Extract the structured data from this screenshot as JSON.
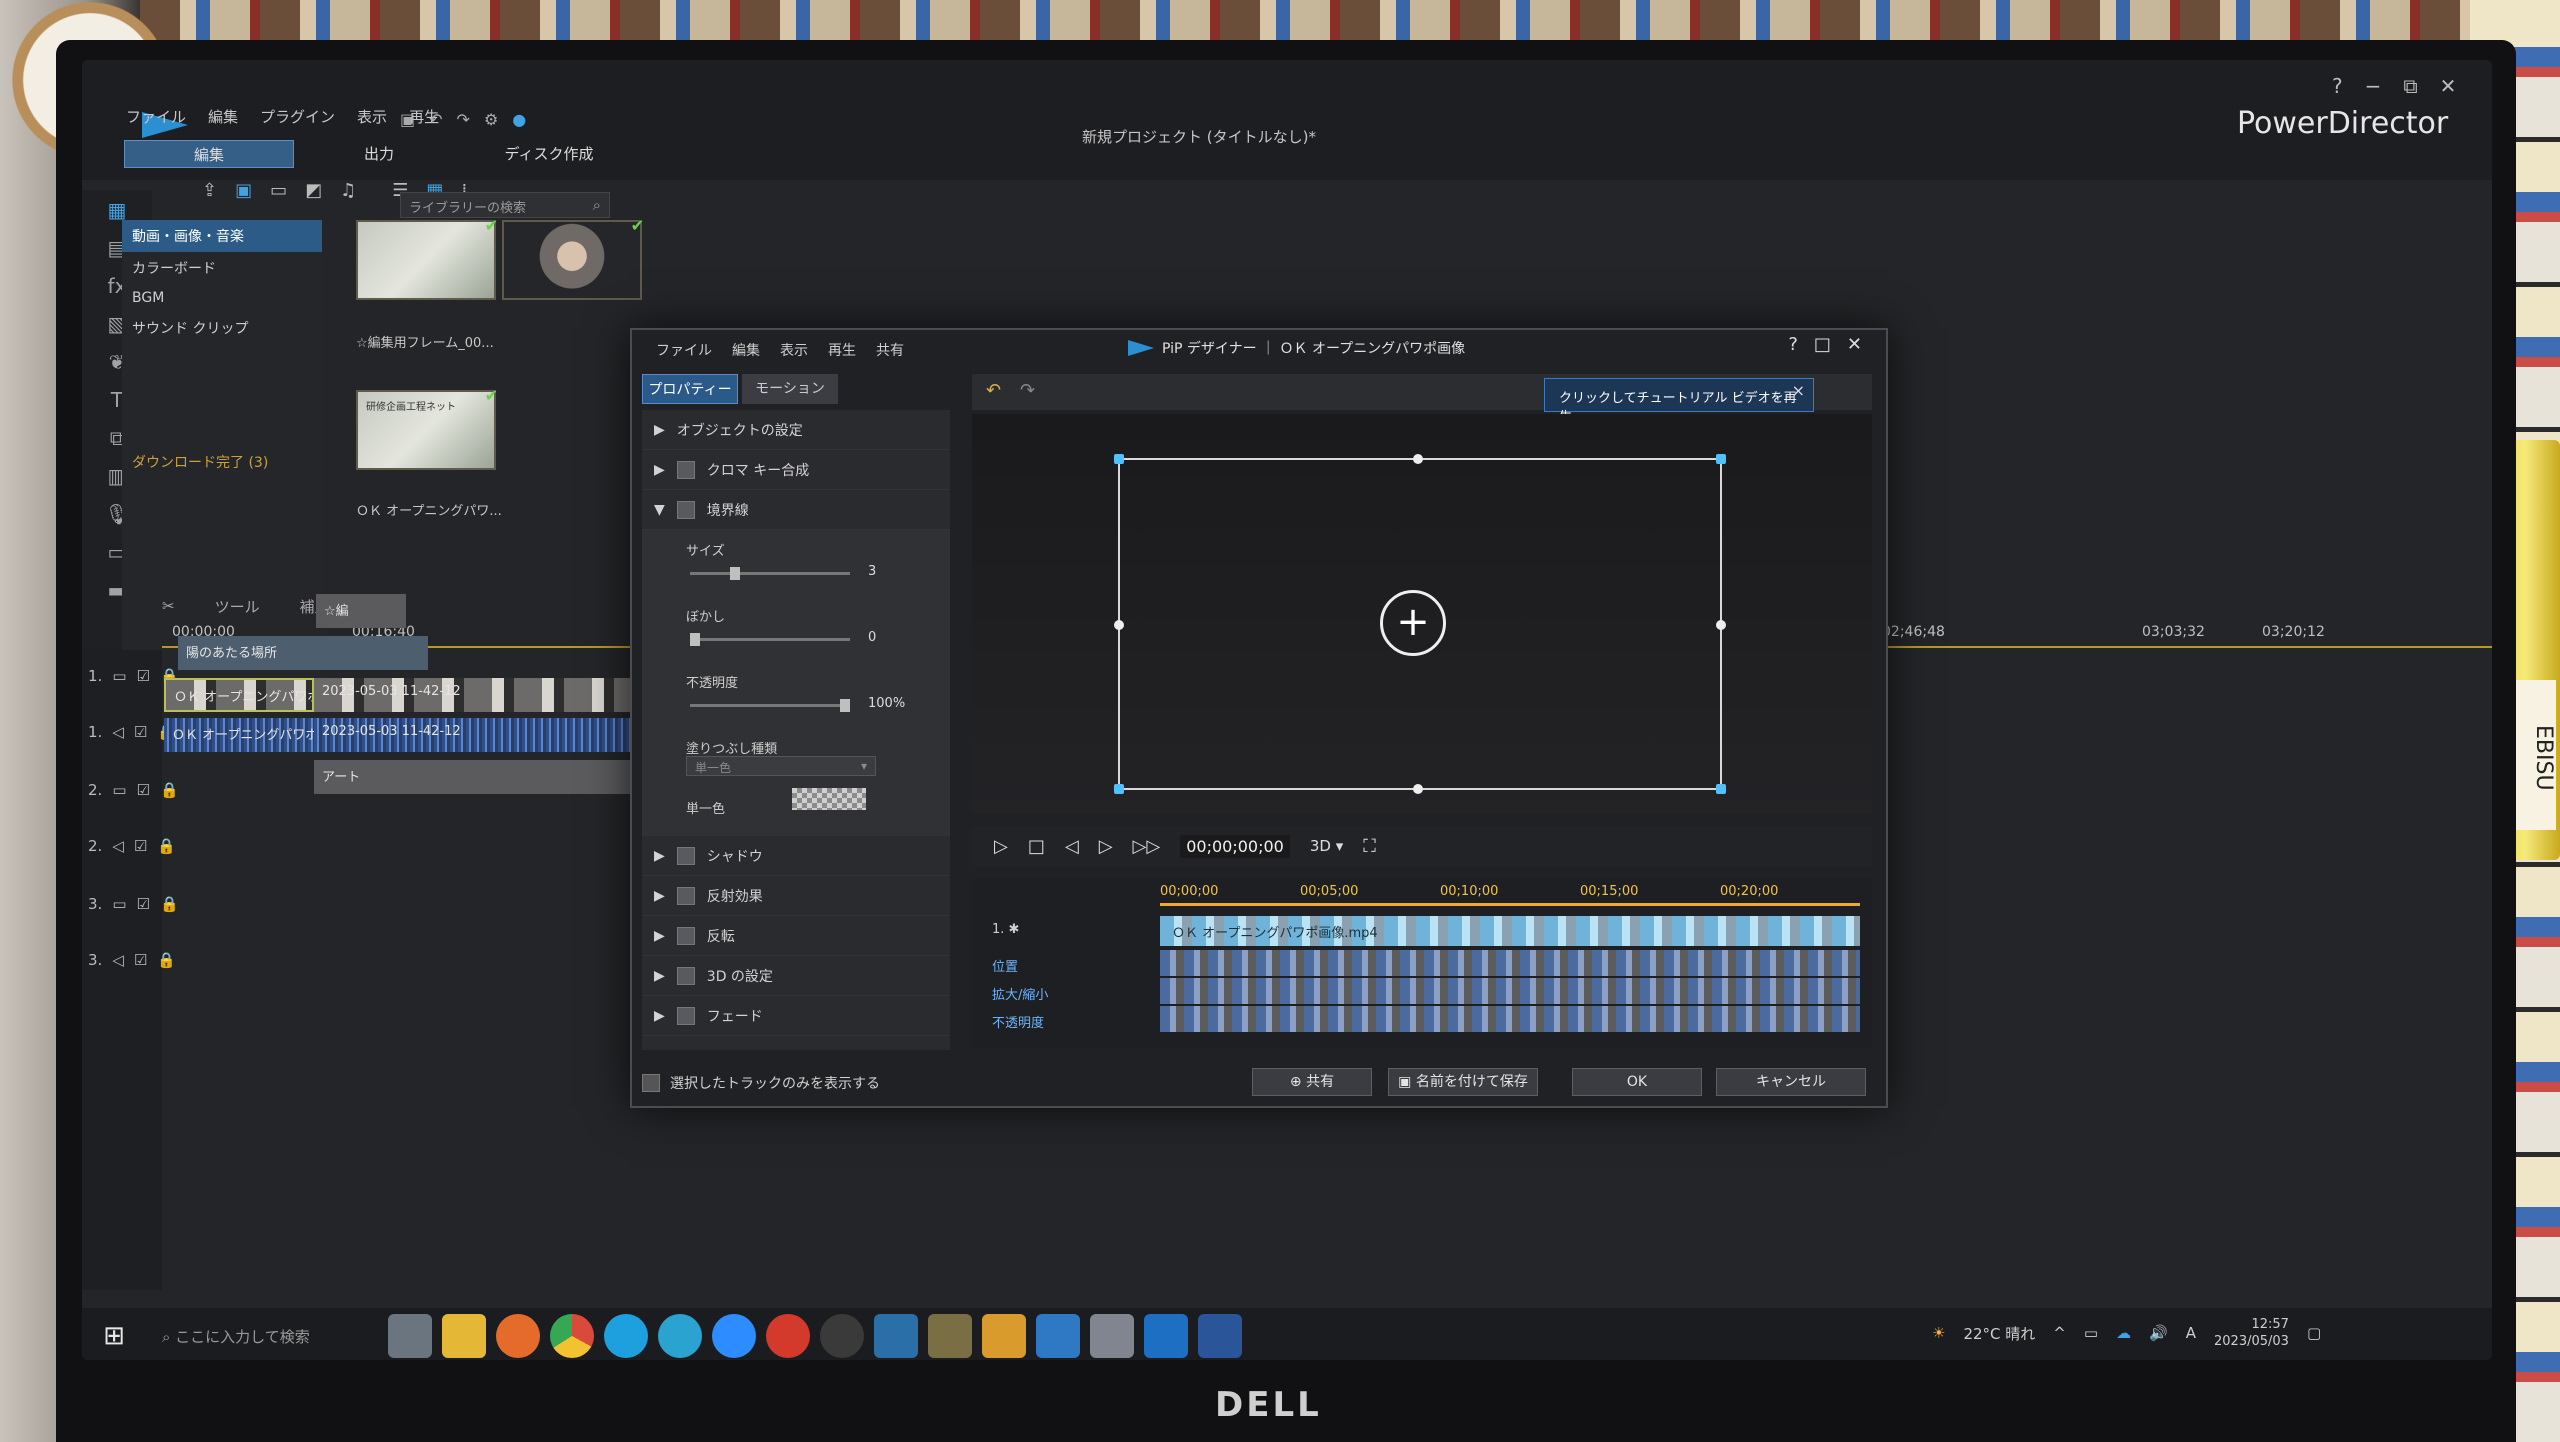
{
  "app": {
    "menu": [
      "ファイル",
      "編集",
      "プラグイン",
      "表示",
      "再生"
    ],
    "mode_tabs": [
      "編集",
      "出力",
      "ディスク作成"
    ],
    "document_title": "新規プロジェクト (タイトルなし)*",
    "brand": "PowerDirector",
    "window_controls": [
      "?",
      "−",
      "⧉",
      "✕"
    ]
  },
  "library": {
    "search_placeholder": "ライブラリーの検索",
    "tree": [
      "動画・画像・音楽",
      "カラーボード",
      "BGM",
      "サウンド クリップ"
    ],
    "download_status": "ダウンロード完了 (3)",
    "thumbs": [
      {
        "caption": "☆編集用フレーム_00..."
      },
      {
        "caption": ""
      },
      {
        "caption": "ＯＫ オープニングパワ..."
      }
    ],
    "thumb3_overlay": "研修企画工程ネット"
  },
  "timeline": {
    "toolbar": {
      "tools": "ツール",
      "correct": "補正/強調"
    },
    "ruler": [
      "00;00;00",
      "00;16;40",
      "02;46;48",
      "03;03;32",
      "03;20;12"
    ],
    "track_labels": [
      "1.",
      "1.",
      "2.",
      "2.",
      "3.",
      "3."
    ],
    "clips": {
      "clip_1a": "☆編",
      "title_1": "陽のあたる場所",
      "video_2": "ＯＫ オープニングパワポ画像",
      "video_2_dup": "2023-05-03 11-42-12",
      "audio_2": "ＯＫ オープニングパワポ画像",
      "audio_2b": "2023-05-03 11-42-12",
      "track_3": "アート"
    }
  },
  "pip": {
    "menu": [
      "ファイル",
      "編集",
      "表示",
      "再生",
      "共有"
    ],
    "title": "PiP デザイナー ｜ ＯＫ オープニングパワポ画像",
    "window_controls": [
      "?",
      "□",
      "✕"
    ],
    "tabs": [
      "プロパティー",
      "モーション"
    ],
    "tutorial_tip": "クリックしてチュートリアル ビデオを再生",
    "properties": {
      "object_settings": "オブジェクトの設定",
      "chroma_key": "クロマ キー合成",
      "border": "境界線",
      "size_label": "サイズ",
      "size_value": "3",
      "blur_label": "ぼかし",
      "blur_value": "0",
      "opacity_label": "不透明度",
      "opacity_value": "100%",
      "fill_type_label": "塗りつぶし種類",
      "fill_type_value": "単一色",
      "single_color_label": "単一色",
      "shadow": "シャドウ",
      "reflection": "反射効果",
      "flip": "反転",
      "3d_settings": "3D の設定",
      "fade": "フェード"
    },
    "player": {
      "timecode": "00;00;00;00",
      "mode_3d": "3D ▾"
    },
    "timeline": {
      "ruler": [
        "00;00;00",
        "00;05;00",
        "00;10;00",
        "00;15;00",
        "00;20;00"
      ],
      "track": "1.",
      "clip": "ＯＫ オープニングパワポ画像.mp4",
      "keyframes": [
        "位置",
        "拡大/縮小",
        "不透明度"
      ]
    },
    "footer": {
      "show_selected_only": "選択したトラックのみを表示する",
      "share": "共有",
      "save_as": "名前を付けて保存",
      "ok": "OK",
      "cancel": "キャンセル"
    }
  },
  "taskbar": {
    "search_placeholder": "ここに入力して検索",
    "weather": "22°C 晴れ",
    "time": "12:57",
    "date": "2023/05/03",
    "ime": "A"
  },
  "hardware": {
    "monitor_brand": "DELL",
    "sticker": "EBISU"
  },
  "colors": {
    "accent": "#2c8fd2",
    "ruler_marker": "#f0a92a",
    "selection": "#2b5a8a"
  }
}
